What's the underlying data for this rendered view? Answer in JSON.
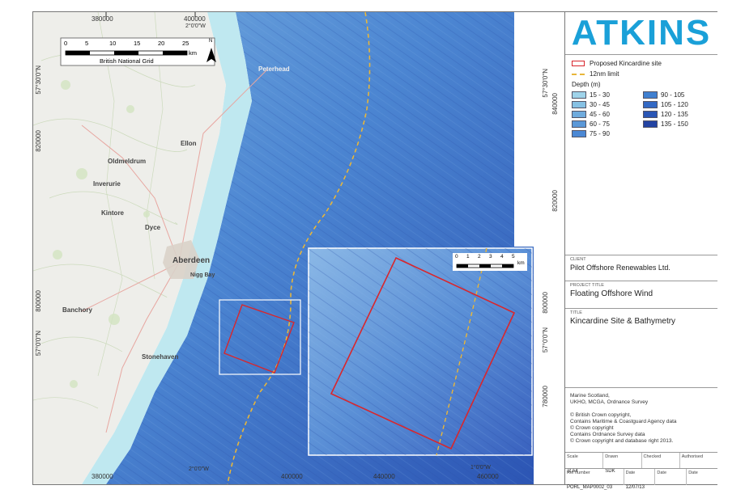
{
  "logo": "ATKINS",
  "legend": {
    "site": "Proposed Kincardine site",
    "limit": "12nm limit",
    "depth_title": "Depth (m)",
    "depth_classes": [
      {
        "label": "15 - 30",
        "color": "#9fd3ea"
      },
      {
        "label": "90 - 105",
        "color": "#3f7fd0"
      },
      {
        "label": "30 - 45",
        "color": "#86c1e4"
      },
      {
        "label": "105 - 120",
        "color": "#3469c4"
      },
      {
        "label": "45 - 60",
        "color": "#6fabdd"
      },
      {
        "label": "120 - 135",
        "color": "#2a56b5"
      },
      {
        "label": "60 - 75",
        "color": "#5b98d8"
      },
      {
        "label": "135 - 150",
        "color": "#2343a2"
      },
      {
        "label": "75 - 90",
        "color": "#4b88d4"
      }
    ]
  },
  "client": {
    "label": "Client",
    "value": "Pilot Offshore Renewables Ltd."
  },
  "project": {
    "label": "Project Title",
    "value": "Floating Offshore Wind"
  },
  "title": {
    "label": "Title",
    "value": "Kincardine Site & Bathymetry"
  },
  "credits": [
    "Marine Scotland,",
    "UKHO, MCGA, Ordnance Survey",
    "",
    "© British Crown copyright,",
    "Contains Maritime & Coastguard Agency data",
    "© Crown copyright",
    "Contains Ordnance Survey data",
    "© Crown copyright and database right 2013."
  ],
  "table": {
    "row1": [
      {
        "label": "Scale",
        "value": "at A4"
      },
      {
        "label": "Drawn",
        "value": "SDK"
      },
      {
        "label": "Checked",
        "value": ""
      },
      {
        "label": "Authorised",
        "value": ""
      }
    ],
    "row2": [
      {
        "label": "Ref number",
        "value": "PORL_MAP0002_03"
      },
      {
        "label": "Date",
        "value": "12/07/13"
      },
      {
        "label": "Date",
        "value": ""
      },
      {
        "label": "Date",
        "value": ""
      }
    ]
  },
  "scalebar": {
    "ticks": [
      "0",
      "5",
      "10",
      "15",
      "20",
      "25"
    ],
    "unit": "km",
    "grid": "British National Grid",
    "north": "N"
  },
  "inset_scale": {
    "ticks": [
      "0",
      "1",
      "2",
      "3",
      "4",
      "5"
    ],
    "unit": "km"
  },
  "coords": {
    "top": [
      "380000",
      "400000",
      "2°0'0\"W"
    ],
    "bottom": [
      "380000",
      "2°0'0\"W",
      "400000",
      "440000",
      "1°0'0\"W",
      "460000"
    ],
    "right": [
      "57°30'0\"N",
      "840000",
      "820000",
      "800000",
      "57°0'0\"N",
      "780000"
    ],
    "left": [
      "57°30'0\"N",
      "820000",
      "800000",
      "57°0'0\"N"
    ]
  },
  "places": {
    "peterhead": "Peterhead",
    "ellon": "Ellon",
    "oldmeldrum": "Oldmeldrum",
    "inverurie": "Inverurie",
    "kintore": "Kintore",
    "dyce": "Dyce",
    "aberdeen": "Aberdeen",
    "nigg": "Nigg Bay",
    "banchory": "Banchory",
    "stonehaven": "Stonehaven"
  },
  "colors": {
    "site": "#d9262c",
    "limit": "#e8b63a",
    "sea": "#3b6fc4",
    "land": "#eeeeea"
  }
}
